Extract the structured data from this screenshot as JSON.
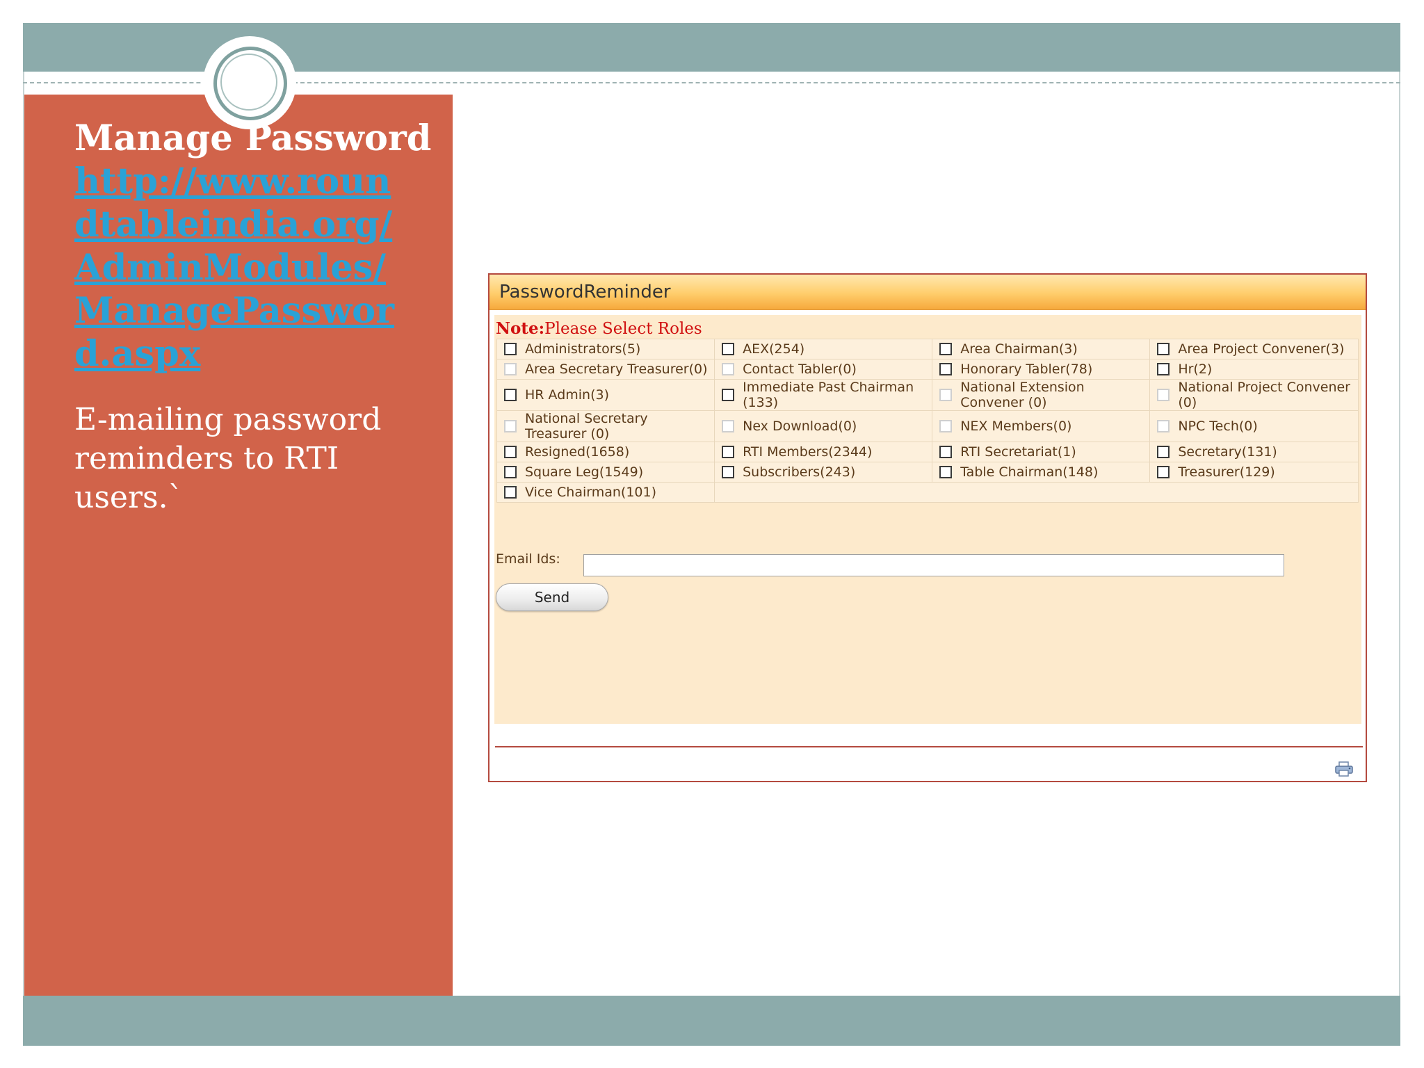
{
  "slide": {
    "title": "Manage Password",
    "link": "http://www.roundtableindia.org/AdminModules/ManagePassword.aspx",
    "body": "E-mailing password reminders to RTI users.`"
  },
  "panel": {
    "title": "PasswordReminder",
    "note_label": "Note:",
    "note_text": "Please Select Roles",
    "roles": [
      [
        "Administrators(5)",
        "AEX(254)",
        "Area Chairman(3)",
        "Area Project Convener(3)"
      ],
      [
        "Area Secretary Treasurer(0)",
        "Contact Tabler(0)",
        "Honorary Tabler(78)",
        "Hr(2)"
      ],
      [
        "HR Admin(3)",
        "Immediate Past Chairman (133)",
        "National Extension Convener (0)",
        "National Project Convener (0)"
      ],
      [
        "National Secretary Treasurer (0)",
        "Nex Download(0)",
        "NEX Members(0)",
        "NPC Tech(0)"
      ],
      [
        "Resigned(1658)",
        "RTI Members(2344)",
        "RTI Secretariat(1)",
        "Secretary(131)"
      ],
      [
        "Square Leg(1549)",
        "Subscribers(243)",
        "Table Chairman(148)",
        "Treasurer(129)"
      ],
      [
        "Vice Chairman(101)"
      ]
    ],
    "email_label": "Email Ids:",
    "email_value": "",
    "send_label": "Send",
    "print_icon": "printer-icon"
  },
  "colors": {
    "top_band": "#8cabab",
    "left_panel": "#d1634a",
    "link": "#2aa2d6",
    "header_orange": "#f6a93c",
    "body_cream": "#fdeacc",
    "note_red": "#d01010"
  }
}
